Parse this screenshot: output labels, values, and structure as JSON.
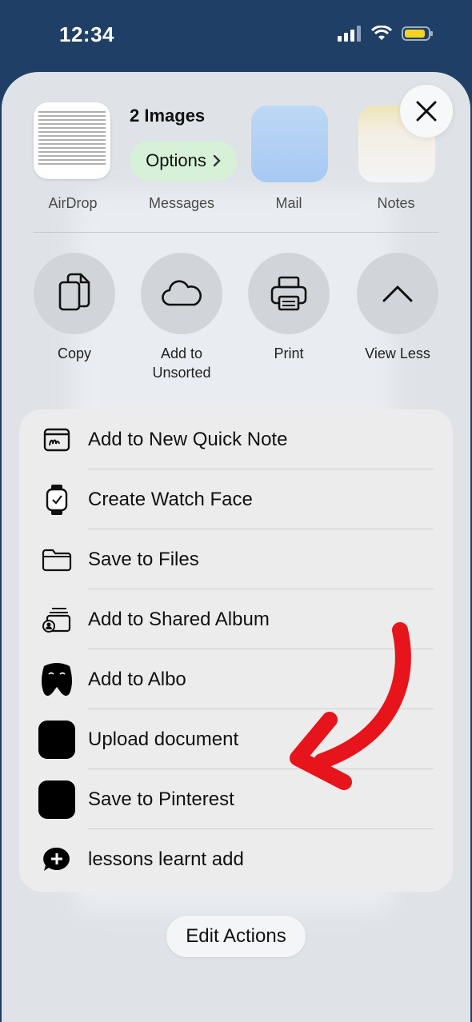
{
  "status": {
    "time": "12:34"
  },
  "share": {
    "count_label": "2 Images",
    "options_label": "Options",
    "apps": [
      {
        "label": "AirDrop"
      },
      {
        "label": "Messages"
      },
      {
        "label": "Mail"
      },
      {
        "label": "Notes"
      }
    ],
    "actions": [
      {
        "label": "Copy",
        "icon": "copy-icon"
      },
      {
        "label": "Add to Unsorted",
        "icon": "cloud-icon"
      },
      {
        "label": "Print",
        "icon": "printer-icon"
      },
      {
        "label": "View Less",
        "icon": "chevron-up-icon"
      }
    ],
    "menu": [
      {
        "label": "Add to New Quick Note",
        "icon": "quick-note-icon"
      },
      {
        "label": "Create Watch Face",
        "icon": "watch-icon"
      },
      {
        "label": "Save to Files",
        "icon": "folder-icon"
      },
      {
        "label": "Add to Shared Album",
        "icon": "shared-album-icon"
      },
      {
        "label": "Add to Albo",
        "icon": "albo-icon"
      },
      {
        "label": "Upload document",
        "icon": "upload-app-icon"
      },
      {
        "label": "Save to Pinterest",
        "icon": "pinterest-app-icon"
      },
      {
        "label": "lessons learnt add",
        "icon": "add-message-icon"
      }
    ],
    "edit_actions_label": "Edit Actions"
  },
  "colors": {
    "sheet_bg": "#dfe3e8",
    "annotation_arrow": "#e8141b",
    "options_bg": "#d6f1d8"
  }
}
